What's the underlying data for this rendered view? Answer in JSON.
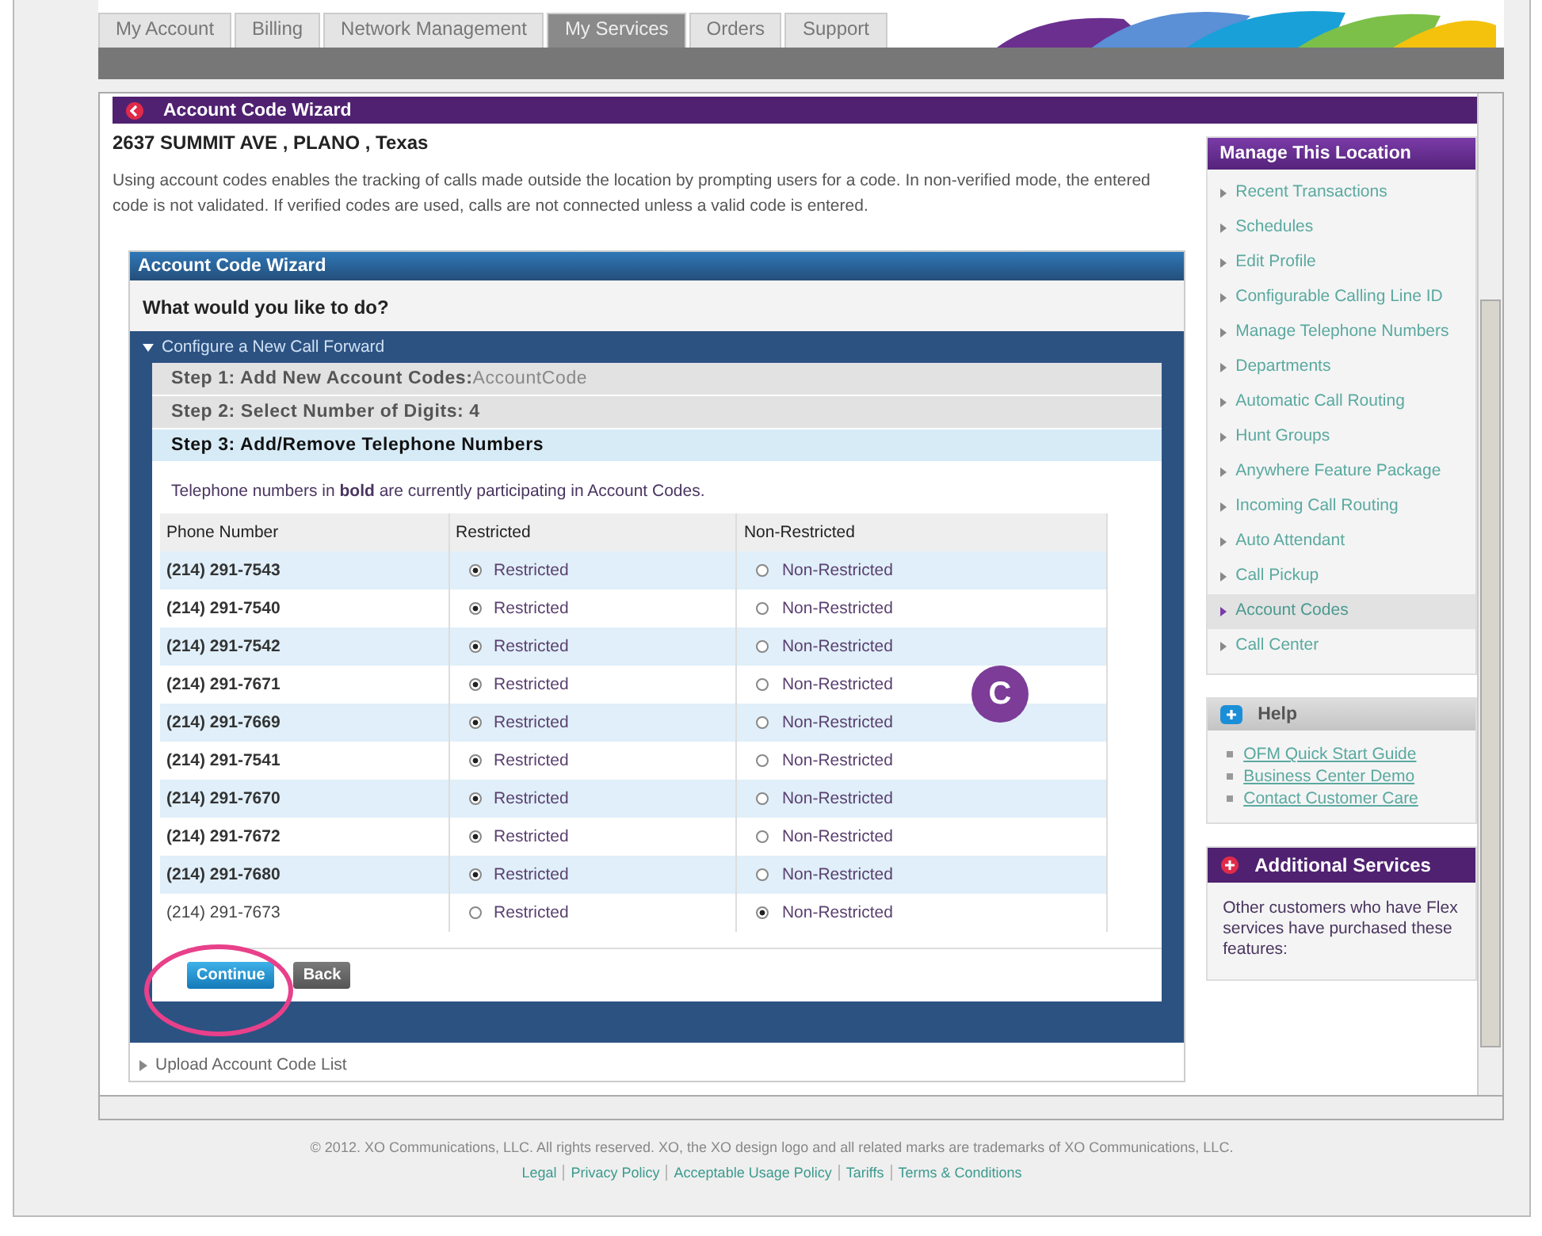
{
  "nav_tabs": [
    {
      "label": "My Account",
      "selected": false
    },
    {
      "label": "Billing",
      "selected": false
    },
    {
      "label": "Network Management",
      "selected": false
    },
    {
      "label": "My Services",
      "selected": true
    },
    {
      "label": "Orders",
      "selected": false
    },
    {
      "label": "Support",
      "selected": false
    }
  ],
  "page_header": {
    "title": "Account Code Wizard"
  },
  "address": "2637 SUMMIT AVE , PLANO , Texas",
  "intro": "Using account codes enables the tracking of calls made outside the location by prompting users for a code. In non-verified mode, the entered code is not validated. If verified codes are used, calls are not connected unless a valid code is entered.",
  "wizard": {
    "title": "Account Code Wizard",
    "question": "What would you like to do?",
    "sections": [
      {
        "label": "Configure a New Call Forward",
        "expanded": true
      },
      {
        "label": "Upload Account Code List",
        "expanded": false
      }
    ],
    "steps": [
      {
        "label": "Step 1: Add New Account Codes:",
        "value": "AccountCode",
        "selected": false
      },
      {
        "label": "Step 2: Select Number of Digits: 4",
        "selected": false
      },
      {
        "label": "Step 3: Add/Remove Telephone Numbers",
        "selected": true
      }
    ],
    "note": "Telephone numbers in **bold** are currently participating in Account Codes.",
    "table": {
      "columns": [
        "Phone Number",
        "Restricted",
        "Non-Restricted"
      ],
      "rows": [
        {
          "phone": "(214) 291-7543",
          "bold": true,
          "restricted": true,
          "restricted_label": "Restricted",
          "non_restricted_label": "Non-Restricted"
        },
        {
          "phone": "(214) 291-7540",
          "bold": true,
          "restricted": true,
          "restricted_label": "Restricted",
          "non_restricted_label": "Non-Restricted"
        },
        {
          "phone": "(214) 291-7542",
          "bold": true,
          "restricted": true,
          "restricted_label": "Restricted",
          "non_restricted_label": "Non-Restricted"
        },
        {
          "phone": "(214) 291-7671",
          "bold": true,
          "restricted": true,
          "restricted_label": "Restricted",
          "non_restricted_label": "Non-Restricted"
        },
        {
          "phone": "(214) 291-7669",
          "bold": true,
          "restricted": true,
          "restricted_label": "Restricted",
          "non_restricted_label": "Non-Restricted"
        },
        {
          "phone": "(214) 291-7541",
          "bold": true,
          "restricted": true,
          "restricted_label": "Restricted",
          "non_restricted_label": "Non-Restricted"
        },
        {
          "phone": "(214) 291-7670",
          "bold": true,
          "restricted": true,
          "restricted_label": "Restricted",
          "non_restricted_label": "Non-Restricted"
        },
        {
          "phone": "(214) 291-7672",
          "bold": true,
          "restricted": true,
          "restricted_label": "Restricted",
          "non_restricted_label": "Non-Restricted"
        },
        {
          "phone": "(214) 291-7680",
          "bold": true,
          "restricted": true,
          "restricted_label": "Restricted",
          "non_restricted_label": "Non-Restricted"
        },
        {
          "phone": "(214) 291-7673",
          "bold": false,
          "restricted": false,
          "restricted_label": "Restricted",
          "non_restricted_label": "Non-Restricted"
        }
      ]
    },
    "buttons": [
      {
        "label": "Continue",
        "kind": "primary"
      },
      {
        "label": "Back",
        "kind": "secondary"
      }
    ]
  },
  "sidebar": {
    "manage": {
      "title": "Manage This Location",
      "items": [
        {
          "label": "Recent Transactions",
          "selected": false
        },
        {
          "label": "Schedules",
          "selected": false
        },
        {
          "label": "Edit Profile",
          "selected": false
        },
        {
          "label": "Configurable Calling Line ID",
          "selected": false
        },
        {
          "label": "Manage Telephone Numbers",
          "selected": false
        },
        {
          "label": "Departments",
          "selected": false
        },
        {
          "label": "Automatic Call Routing",
          "selected": false
        },
        {
          "label": "Hunt Groups",
          "selected": false
        },
        {
          "label": "Anywhere Feature Package",
          "selected": false
        },
        {
          "label": "Incoming Call Routing",
          "selected": false
        },
        {
          "label": "Auto Attendant",
          "selected": false
        },
        {
          "label": "Call Pickup",
          "selected": false
        },
        {
          "label": "Account Codes",
          "selected": true
        },
        {
          "label": "Call Center",
          "selected": false
        }
      ]
    },
    "help": {
      "title": "Help",
      "links": [
        "OFM Quick Start Guide",
        "Business Center Demo",
        "Contact Customer Care"
      ]
    },
    "additional": {
      "title": "Additional Services",
      "text": "Other customers who have Flex services have purchased these features:"
    }
  },
  "footer": {
    "copyright": "© 2012. XO Communications, LLC. All rights reserved. XO, the XO design logo and all related marks are trademarks of XO Communications, LLC.",
    "links": [
      "Legal",
      "Privacy Policy",
      "Acceptable Usage Policy",
      "Tariffs",
      "Terms & Conditions"
    ]
  },
  "callout": {
    "label": "C"
  }
}
